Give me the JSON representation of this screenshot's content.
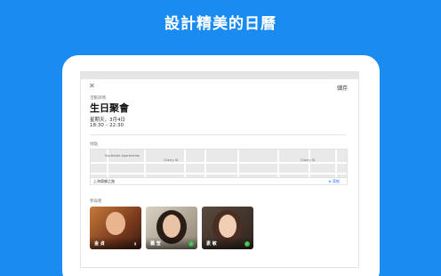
{
  "headline": "設計精美的日曆",
  "screen": {
    "close_glyph": "✕",
    "save_label": "儲存",
    "detail_label": "活動詳情",
    "event_title": "生日聚會",
    "event_date": "星期天，3月4日",
    "event_time": "18:30 – 22:30",
    "location_label": "地點",
    "map": {
      "poi_1": "Southside Apartments",
      "street_1": "Cherry St",
      "street_2": "Cherry St",
      "address": "上海錦鶴之路",
      "navigate": "導航",
      "navigate_icon": "navigation-arrow-icon"
    },
    "guests_label": "參與者",
    "guests": [
      {
        "name": "金 貞",
        "status": "pending",
        "badge": "▮"
      },
      {
        "name": "霜 莹",
        "status": "accepted",
        "badge": "✓"
      },
      {
        "name": "素 敏",
        "status": "accepted",
        "badge": "✓"
      }
    ]
  },
  "colors": {
    "background": "#1a8bf0",
    "accept": "#3bb54a"
  }
}
